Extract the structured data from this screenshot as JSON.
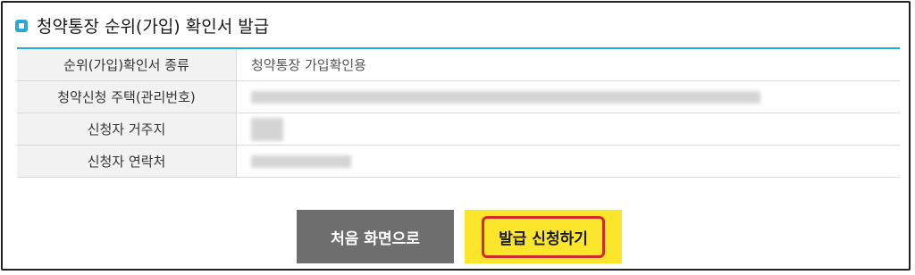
{
  "header": {
    "title": "청약통장 순위(가입) 확인서 발급",
    "icon": "square-bullet-icon",
    "accent_color": "#2aa9d6"
  },
  "table": {
    "rows": [
      {
        "label": "순위(가입)확인서 종류",
        "value": "청약통장 가입확인용"
      },
      {
        "label": "청약신청 주택(관리번호)",
        "value": ""
      },
      {
        "label": "신청자 거주지",
        "value": ""
      },
      {
        "label": "신청자 연락처",
        "value": ""
      }
    ]
  },
  "buttons": {
    "home_label": "처음 화면으로",
    "apply_label": "발급 신청하기",
    "highlight_color": "#d42a2a"
  }
}
